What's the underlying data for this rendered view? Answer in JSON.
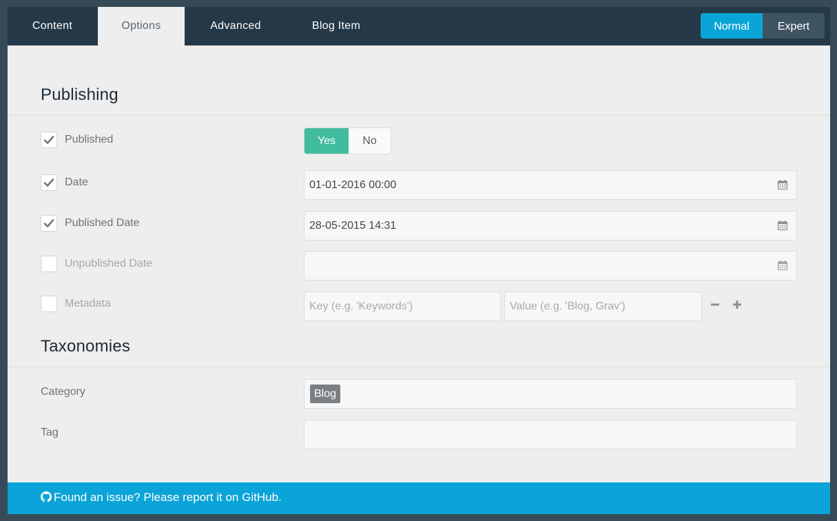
{
  "tabs": [
    {
      "label": "Content"
    },
    {
      "label": "Options"
    },
    {
      "label": "Advanced"
    },
    {
      "label": "Blog Item"
    }
  ],
  "active_tab": "Options",
  "mode": {
    "normal": "Normal",
    "expert": "Expert",
    "selected": "Normal"
  },
  "sections": {
    "publishing": "Publishing",
    "taxonomies": "Taxonomies"
  },
  "publishing": {
    "published": {
      "label": "Published",
      "checked": true,
      "yes": "Yes",
      "no": "No",
      "value": "Yes"
    },
    "date": {
      "label": "Date",
      "checked": true,
      "value": "01-01-2016 00:00"
    },
    "published_date": {
      "label": "Published Date",
      "checked": true,
      "value": "28-05-2015 14:31"
    },
    "unpublished_date": {
      "label": "Unpublished Date",
      "checked": false,
      "value": ""
    },
    "metadata": {
      "label": "Metadata",
      "checked": false,
      "key_placeholder": "Key (e.g. 'Keywords')",
      "value_placeholder": "Value (e.g. 'Blog, Grav')"
    }
  },
  "taxonomies": {
    "category": {
      "label": "Category",
      "tags": [
        "Blog"
      ]
    },
    "tag": {
      "label": "Tag",
      "tags": []
    }
  },
  "footer": {
    "text": "Found an issue? Please report it on GitHub."
  },
  "colors": {
    "accent": "#0ba4d8",
    "toggle_on": "#41bc9e",
    "tabbar": "#243847",
    "panel": "#eeeeee"
  },
  "icons": {
    "calendar": "calendar-icon",
    "check": "check-icon",
    "minus": "minus-icon",
    "plus": "plus-icon",
    "github": "github-icon"
  }
}
